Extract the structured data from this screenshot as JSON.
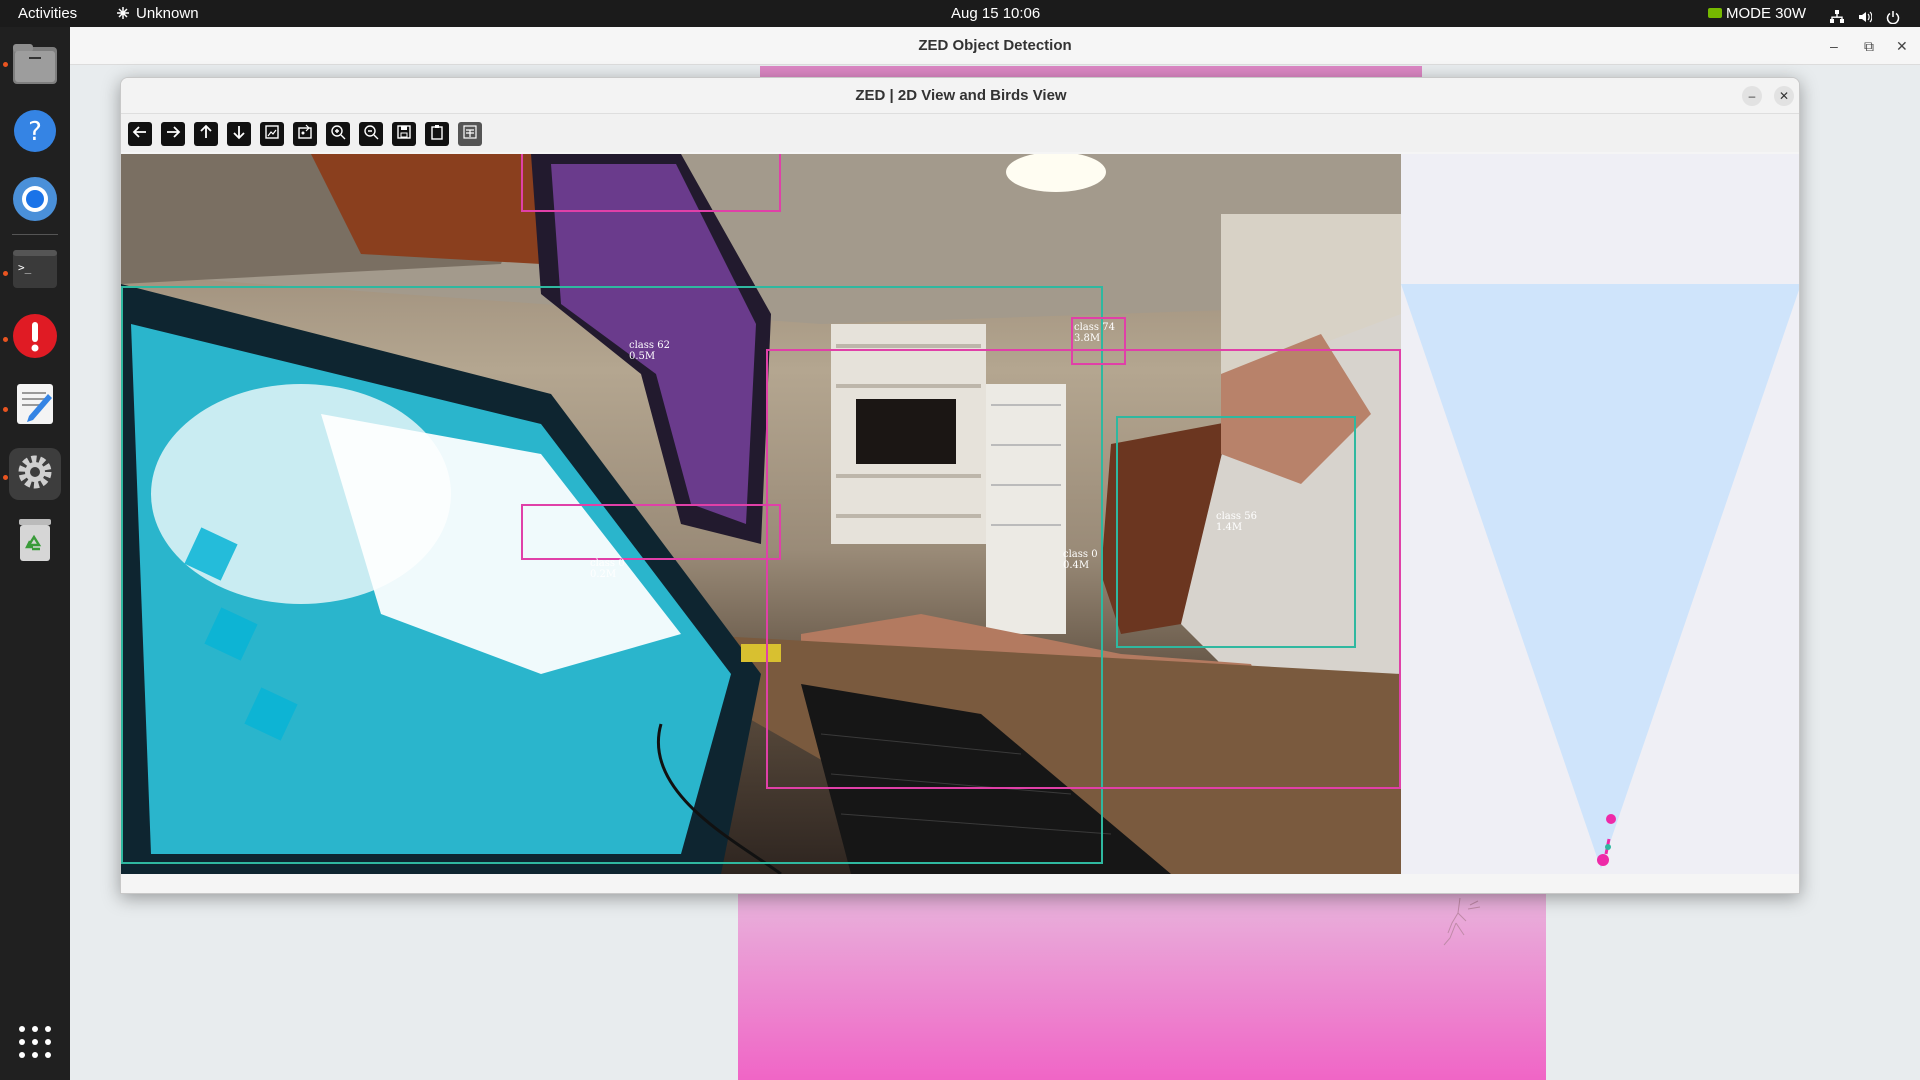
{
  "topbar": {
    "activities": "Activities",
    "network_label": "Unknown",
    "clock": "Aug 15  10:06",
    "power_mode": "MODE 30W"
  },
  "dock": {
    "apps": [
      {
        "name": "files-icon",
        "running": true
      },
      {
        "name": "help-icon",
        "running": false
      },
      {
        "name": "chromium-icon",
        "running": false
      },
      {
        "name": "terminal-icon",
        "running": true
      },
      {
        "name": "software-updater-icon",
        "running": true
      },
      {
        "name": "text-editor-icon",
        "running": true
      },
      {
        "name": "settings-icon",
        "running": true
      },
      {
        "name": "trash-icon",
        "running": false
      }
    ]
  },
  "background_window": {
    "title": "ZED Object Detection"
  },
  "main_window": {
    "title": "ZED | 2D View and Birds View",
    "toolbar": [
      "arrow-left-icon",
      "arrow-right-icon",
      "arrow-up-icon",
      "arrow-down-icon",
      "image-icon",
      "image-edit-icon",
      "zoom-in-icon",
      "zoom-out-icon",
      "save-icon",
      "clipboard-icon",
      "properties-icon"
    ]
  },
  "detections": [
    {
      "label": "class 62",
      "distance": "0.5M",
      "color": "#2fb8a0"
    },
    {
      "label": "class 74",
      "distance": "3.8M",
      "color": "#e040a8"
    },
    {
      "label": "class 56",
      "distance": "1.4M",
      "color": "#2fb8a0"
    },
    {
      "label": "class 0",
      "distance": "0.4M",
      "color": "#e040a8"
    },
    {
      "label": "class 0",
      "distance": "0.2M",
      "color": "#e040a8"
    }
  ],
  "colors": {
    "teal_box": "#2fb8a0",
    "pink_box": "#e040a8",
    "birds_fov": "#cfe4fb",
    "birds_bg": "#efeff5"
  }
}
